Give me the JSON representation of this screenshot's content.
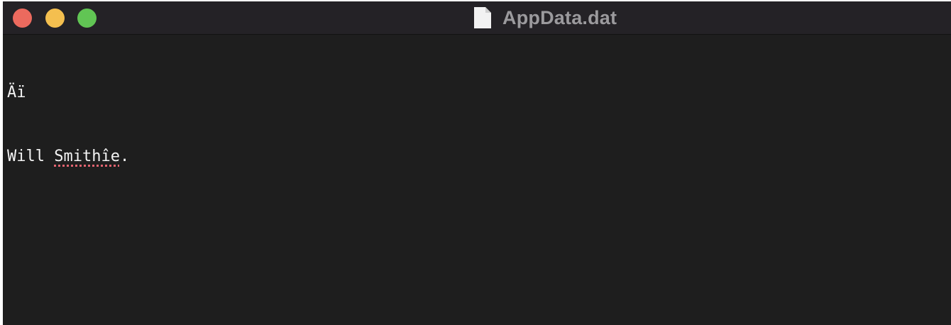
{
  "window": {
    "title": "AppData.dat",
    "title_icon": "document-icon",
    "controls": [
      "close",
      "minimize",
      "zoom"
    ],
    "colors": {
      "close": "#ec6a5e",
      "minimize": "#f4bf4f",
      "zoom": "#61c554",
      "background": "#1e1e1e",
      "text": "#f3f3f3",
      "spellcheck_underline": "#e26470"
    }
  },
  "editor": {
    "line1": "Äï",
    "line2_prefix": "Will ",
    "line2_flagged": "Smithîe",
    "line2_suffix": "."
  }
}
